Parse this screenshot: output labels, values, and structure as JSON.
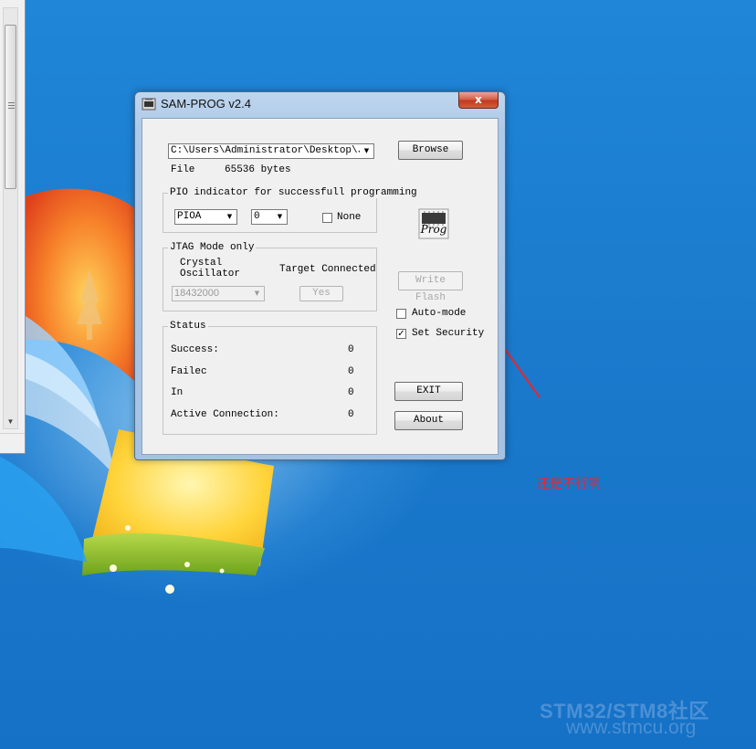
{
  "app": {
    "title": "SAM-PROG v2.4",
    "close_glyph": "x",
    "file_path": "C:\\Users\\Administrator\\Desktop\\JLI",
    "browse_label": "Browse",
    "file_label": "File",
    "file_size": "65536 bytes",
    "pio_group": {
      "legend": "PIO indicator for successfull programming",
      "port_value": "PIOA",
      "pin_value": "0",
      "none_label": "None",
      "none_checked": false
    },
    "jtag_group": {
      "legend": "JTAG Mode only",
      "crystal_label_1": "Crystal",
      "crystal_label_2": "Oscillator",
      "crystal_value": "18432000",
      "target_label": "Target Connected",
      "target_value": "Yes"
    },
    "status_group": {
      "legend": "Status",
      "rows": [
        {
          "label": "Success:",
          "value": "0"
        },
        {
          "label": "Failec",
          "value": "0"
        },
        {
          "label": "In",
          "value": "0"
        },
        {
          "label": "Active Connection:",
          "value": "0"
        }
      ]
    },
    "prog_icon_label": "Prog",
    "write_flash_label": "Write Flash",
    "auto_mode_label": "Auto-mode",
    "auto_mode_checked": false,
    "set_security_label": "Set Security",
    "set_security_checked": true,
    "check_glyph": "✓",
    "exit_label": "EXIT",
    "about_label": "About"
  },
  "annotation": {
    "text": "还是不行啊",
    "color": "#e8262d"
  },
  "watermark": {
    "line1": "STM32/STM8社区",
    "line2": "www.stmcu.org"
  },
  "colors": {
    "desktop_blue": "#1a7bd0",
    "window_frame": "#a5c2e2",
    "close_red": "#c2391c"
  }
}
